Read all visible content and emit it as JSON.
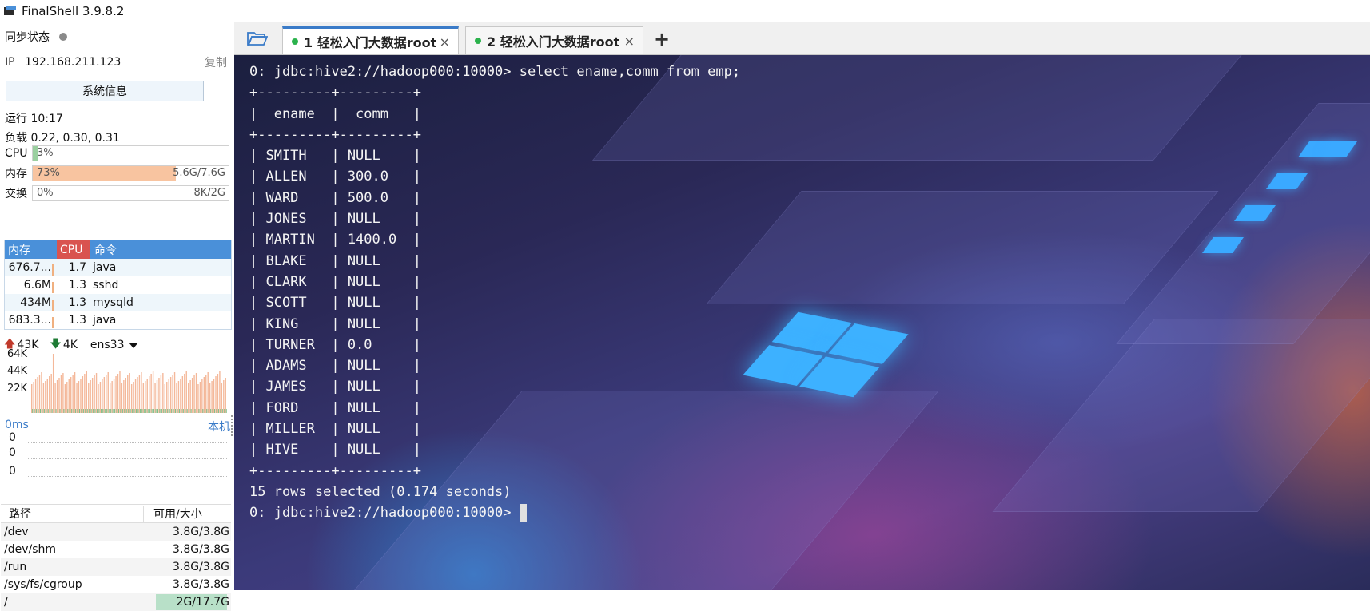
{
  "app": {
    "title": "FinalShell 3.9.8.2"
  },
  "sidebar": {
    "sync_label": "同步状态",
    "ip_label": "IP",
    "ip_value": "192.168.211.123",
    "copy_label": "复制",
    "sysinfo_button": "系统信息",
    "uptime": "运行 10:17",
    "load": "负载 0.22, 0.30, 0.31",
    "meters": {
      "cpu": {
        "label": "CPU",
        "left": "3%",
        "right": "",
        "fraction": 0.03,
        "color": "#9bd0a0"
      },
      "mem": {
        "label": "内存",
        "left": "73%",
        "right": "5.6G/7.6G",
        "fraction": 0.73,
        "color": "#f8c4a0"
      },
      "swap": {
        "label": "交换",
        "left": "0%",
        "right": "8K/2G",
        "fraction": 0.0,
        "color": "#cccccc"
      }
    },
    "process_table": {
      "headers": {
        "mem": "内存",
        "cpu": "CPU",
        "cmd": "命令"
      },
      "rows": [
        {
          "mem": "676.7...",
          "cpu": "1.7",
          "cmd": "java"
        },
        {
          "mem": "6.6M",
          "cpu": "1.3",
          "cmd": "sshd"
        },
        {
          "mem": "434M",
          "cpu": "1.3",
          "cmd": "mysqld"
        },
        {
          "mem": "683.3...",
          "cpu": "1.3",
          "cmd": "java"
        }
      ]
    },
    "network": {
      "up_arrow": "🡅",
      "down_arrow": "🡇",
      "up": "43K",
      "down": "4K",
      "interface": "ens33",
      "y_labels": [
        "64K",
        "44K",
        "22K"
      ]
    },
    "ping": {
      "latency": "0ms",
      "target": "本机",
      "values": [
        "0",
        "0",
        "0"
      ]
    },
    "disks": {
      "headers": {
        "path": "路径",
        "size": "可用/大小"
      },
      "rows": [
        {
          "path": "/dev",
          "size": "3.8G/3.8G",
          "used_fraction": 0.0
        },
        {
          "path": "/dev/shm",
          "size": "3.8G/3.8G",
          "used_fraction": 0.0
        },
        {
          "path": "/run",
          "size": "3.8G/3.8G",
          "used_fraction": 0.0
        },
        {
          "path": "/sys/fs/cgroup",
          "size": "3.8G/3.8G",
          "used_fraction": 0.0
        },
        {
          "path": "/",
          "size": "2G/17.7G",
          "used_fraction": 0.89
        }
      ]
    }
  },
  "tabs": [
    {
      "label": "1 轻松入门大数据root",
      "active": true,
      "close": "×"
    },
    {
      "label": "2 轻松入门大数据root",
      "active": false,
      "close": "×"
    }
  ],
  "tab_add_label": "+",
  "terminal": {
    "lines": [
      "0: jdbc:hive2://hadoop000:10000> select ename,comm from emp;",
      "+---------+---------+",
      "|  ename  |  comm   |",
      "+---------+---------+",
      "| SMITH   | NULL    |",
      "| ALLEN   | 300.0   |",
      "| WARD    | 500.0   |",
      "| JONES   | NULL    |",
      "| MARTIN  | 1400.0  |",
      "| BLAKE   | NULL    |",
      "| CLARK   | NULL    |",
      "| SCOTT   | NULL    |",
      "| KING    | NULL    |",
      "| TURNER  | 0.0     |",
      "| ADAMS   | NULL    |",
      "| JAMES   | NULL    |",
      "| FORD    | NULL    |",
      "| MILLER  | NULL    |",
      "| HIVE    | NULL    |",
      "+---------+---------+",
      "15 rows selected (0.174 seconds)"
    ],
    "prompt": "0: jdbc:hive2://hadoop000:10000> "
  }
}
